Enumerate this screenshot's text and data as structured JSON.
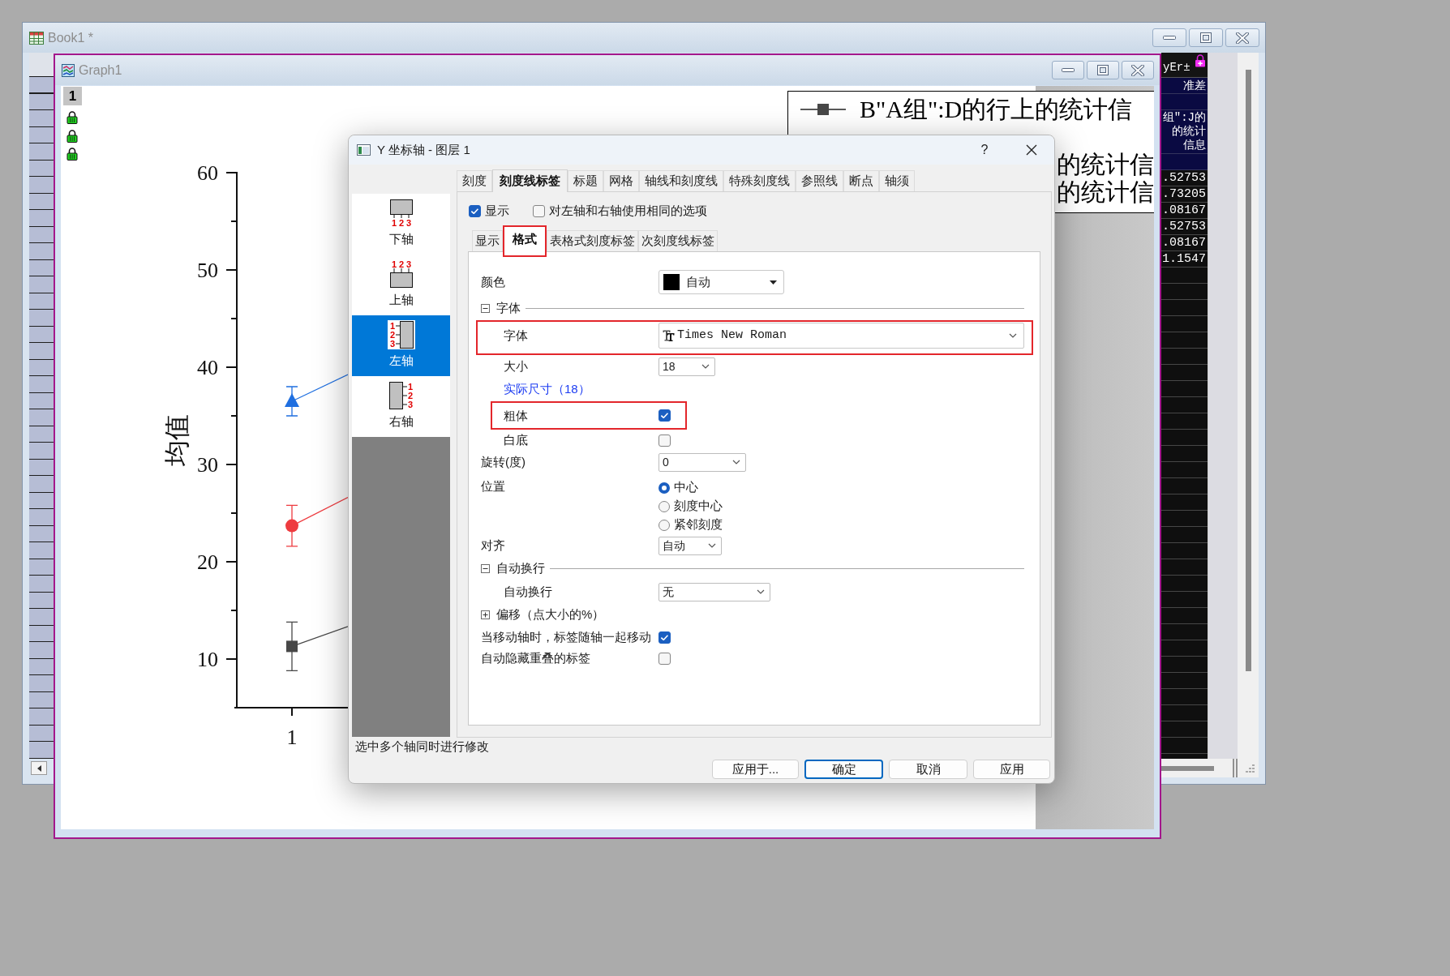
{
  "workbook": {
    "title": "Book1 *",
    "column": {
      "header": "yEr±",
      "long_name": "准差",
      "comments": [
        "组\":J的",
        "的统计",
        "信息"
      ],
      "cells": [
        ".52753",
        ".73205",
        ".08167",
        ".52753",
        ".08167",
        "1.1547"
      ]
    }
  },
  "graph": {
    "title": "Graph1",
    "layer": "1",
    "legend": [
      "B\"A组\":D的行上的统计信",
      "的统计信",
      "的统计信"
    ],
    "chart_data": {
      "type": "line",
      "ylabel": "均值",
      "categories": [
        "1"
      ],
      "yticks": [
        {
          "value": 10,
          "label": "10"
        },
        {
          "value": 20,
          "label": "20"
        },
        {
          "value": 30,
          "label": "30"
        },
        {
          "value": 40,
          "label": "40"
        },
        {
          "value": 50,
          "label": "50"
        },
        {
          "value": 60,
          "label": "60"
        }
      ],
      "ylim": [
        5,
        60
      ],
      "series": [
        {
          "color": "#1f6fe0",
          "marker": "triangle",
          "values": [
            36.5
          ],
          "errors": [
            1.5
          ]
        },
        {
          "color": "#ee3b3f",
          "marker": "circle",
          "values": [
            23.7
          ],
          "errors": [
            2.1
          ]
        },
        {
          "color": "#474747",
          "marker": "square",
          "values": [
            11.3
          ],
          "errors": [
            2.5
          ]
        }
      ]
    }
  },
  "dialog": {
    "title": "Y 坐标轴 - 图层 1",
    "help": "?",
    "tabs": [
      {
        "label": "刻度",
        "selected": false
      },
      {
        "label": "刻度线标签",
        "selected": true
      },
      {
        "label": "标题",
        "selected": false
      },
      {
        "label": "网格",
        "selected": false
      },
      {
        "label": "轴线和刻度线",
        "selected": false
      },
      {
        "label": "特殊刻度线",
        "selected": false
      },
      {
        "label": "参照线",
        "selected": false
      },
      {
        "label": "断点",
        "selected": false
      },
      {
        "label": "轴须",
        "selected": false
      }
    ],
    "axes": [
      {
        "kind": "bottom",
        "label": "下轴",
        "digits": [
          "1",
          "2",
          "3"
        ],
        "selected": false
      },
      {
        "kind": "top",
        "label": "上轴",
        "digits": [
          "1",
          "2",
          "3"
        ],
        "selected": false
      },
      {
        "kind": "left",
        "label": "左轴",
        "digits": [
          "1",
          "2",
          "3"
        ],
        "selected": true
      },
      {
        "kind": "right",
        "label": "右轴",
        "digits": [
          "1",
          "2",
          "3"
        ],
        "selected": false
      }
    ],
    "options": [
      {
        "label": "显示",
        "checked": true
      },
      {
        "label": "对左轴和右轴使用相同的选项",
        "checked": false
      }
    ],
    "subtabs": [
      {
        "label": "显示",
        "selected": false,
        "highlighted": false
      },
      {
        "label": "格式",
        "selected": true,
        "highlighted": true
      },
      {
        "label": "表格式刻度标签",
        "selected": false,
        "highlighted": false
      },
      {
        "label": "次刻度线标签",
        "selected": false,
        "highlighted": false
      }
    ],
    "rows": [
      {
        "kind": "color",
        "label": "颜色",
        "value": "自动",
        "color": "#000000"
      },
      {
        "kind": "group",
        "label": "字体",
        "expanded": true,
        "children": [
          {
            "kind": "font",
            "label": "字体",
            "value": "Times New Roman",
            "highlighted": true
          },
          {
            "kind": "select",
            "label": "大小",
            "value": "18",
            "highlighted": false
          },
          {
            "kind": "link",
            "label": "实际尺寸（18）",
            "highlighted": false
          },
          {
            "kind": "check",
            "label": "粗体",
            "checked": true,
            "highlighted": true
          },
          {
            "kind": "check",
            "label": "白底",
            "checked": false,
            "highlighted": false
          }
        ]
      },
      {
        "kind": "select",
        "label": "旋转(度)",
        "value": "0"
      },
      {
        "kind": "radio",
        "label": "位置",
        "options": [
          {
            "label": "中心",
            "selected": true
          },
          {
            "label": "刻度中心",
            "selected": false
          },
          {
            "label": "紧邻刻度",
            "selected": false
          }
        ]
      },
      {
        "kind": "select",
        "label": "对齐",
        "value": "自动"
      },
      {
        "kind": "group",
        "label": "自动换行",
        "expanded": true,
        "children": [
          {
            "kind": "select",
            "label": "自动换行",
            "value": "无"
          }
        ]
      },
      {
        "kind": "group",
        "label": "偏移（点大小的%）",
        "expanded": false
      },
      {
        "kind": "check",
        "label": "当移动轴时，标签随轴一起移动",
        "checked": true
      },
      {
        "kind": "check",
        "label": "自动隐藏重叠的标签",
        "checked": false
      }
    ],
    "hint": "选中多个轴同时进行修改",
    "buttons": [
      {
        "label": "应用于...",
        "default": false
      },
      {
        "label": "确定",
        "default": true
      },
      {
        "label": "取消",
        "default": false
      },
      {
        "label": "应用",
        "default": false
      }
    ]
  }
}
